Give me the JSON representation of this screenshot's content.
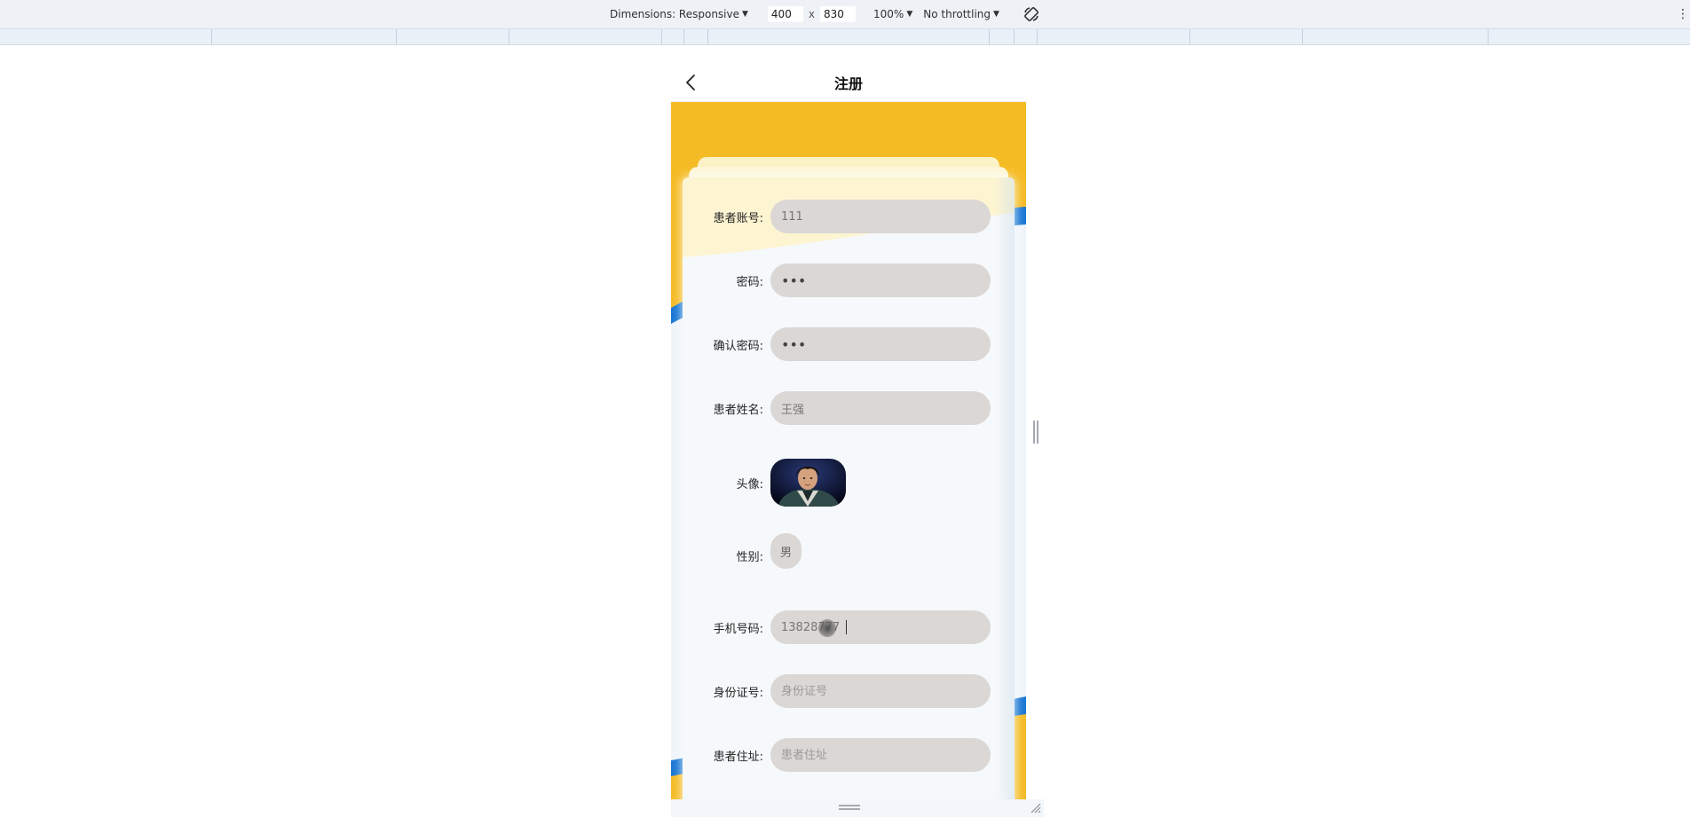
{
  "devtools": {
    "dimensions_label": "Dimensions: Responsive",
    "width": "400",
    "times": "x",
    "height": "830",
    "zoom": "100%",
    "throttling": "No throttling",
    "more_label": "⋮",
    "caret": "▼"
  },
  "page": {
    "title": "注册",
    "back_icon": "chevron-left-icon",
    "accent_yellow": "#f5bb24",
    "accent_blue": "#1776d3"
  },
  "form": {
    "account": {
      "label": "患者账号:",
      "value": "111",
      "placeholder": ""
    },
    "password": {
      "label": "密码:",
      "value": "•••"
    },
    "confirm_password": {
      "label": "确认密码:",
      "value": "•••"
    },
    "name": {
      "label": "患者姓名:",
      "value": "王强",
      "placeholder": ""
    },
    "avatar": {
      "label": "头像:"
    },
    "gender": {
      "label": "性别:",
      "value": "男"
    },
    "phone": {
      "label": "手机号码:",
      "value": "13828777",
      "placeholder": ""
    },
    "id_card": {
      "label": "身份证号:",
      "value": "",
      "placeholder": "身份证号"
    },
    "address": {
      "label": "患者住址:",
      "value": "",
      "placeholder": "患者住址"
    }
  }
}
